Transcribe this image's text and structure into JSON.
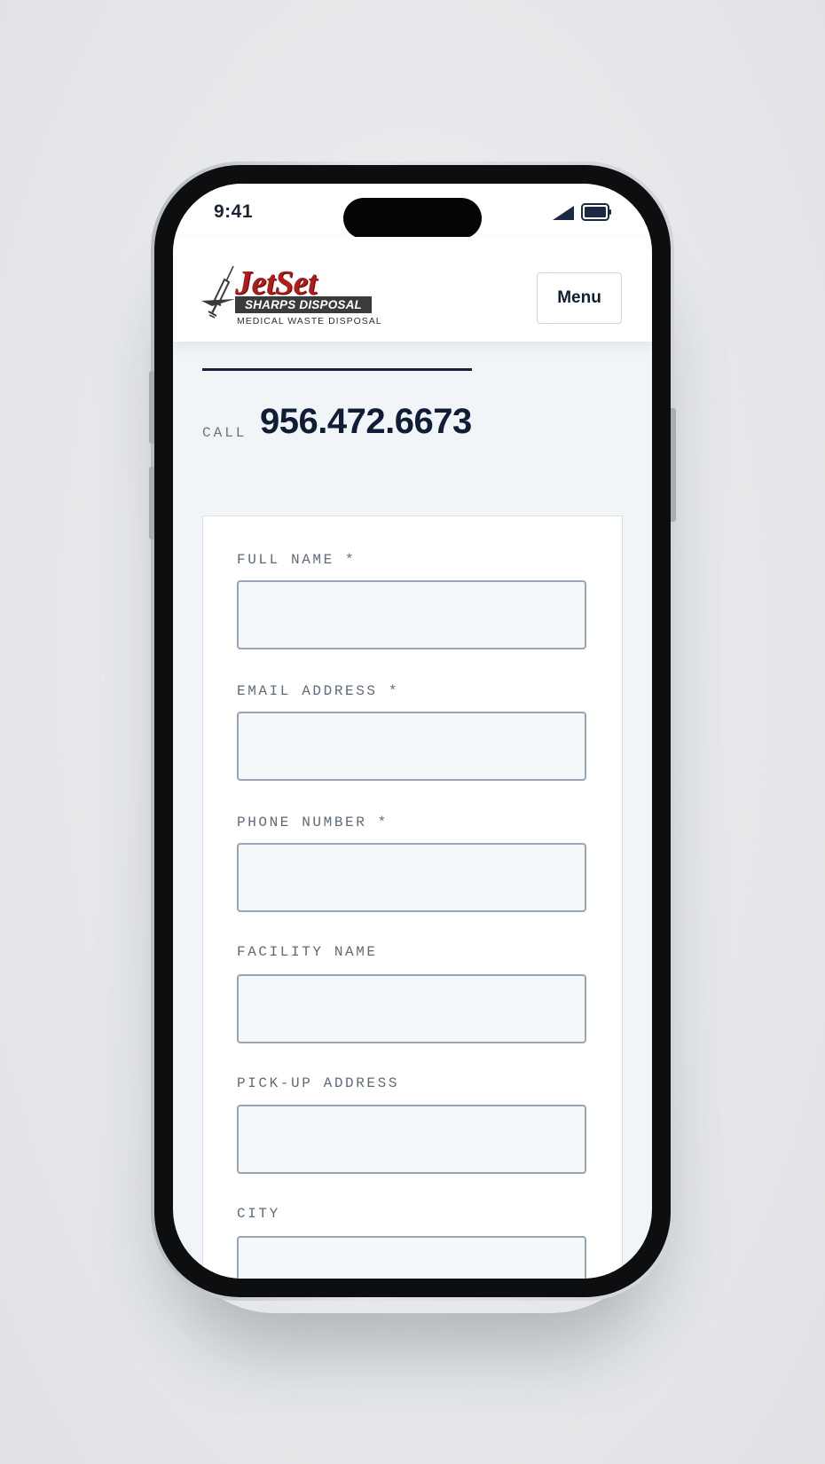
{
  "status_bar": {
    "time": "9:41",
    "icons": [
      "cellular-signal-icon",
      "battery-icon"
    ]
  },
  "header": {
    "logo": {
      "brand": "JetSet",
      "tagline": "SHARPS DISPOSAL",
      "subline": "MEDICAL WASTE DISPOSAL",
      "icon": "syringe-icon"
    },
    "menu_label": "Menu"
  },
  "call": {
    "label": "CALL",
    "number": "956.472.6673"
  },
  "form": {
    "fields": [
      {
        "label": "FULL NAME *",
        "value": "",
        "placeholder": ""
      },
      {
        "label": "EMAIL ADDRESS *",
        "value": "",
        "placeholder": ""
      },
      {
        "label": "PHONE NUMBER *",
        "value": "",
        "placeholder": ""
      },
      {
        "label": "FACILITY NAME",
        "value": "",
        "placeholder": ""
      },
      {
        "label": "PICK-UP ADDRESS",
        "value": "",
        "placeholder": ""
      },
      {
        "label": "CITY",
        "value": "",
        "placeholder": ""
      }
    ]
  },
  "colors": {
    "brand_red": "#b01c1c",
    "navy": "#0f1e36",
    "label_gray": "#5f6a7a",
    "input_border": "#9aa5b3",
    "input_bg": "#f5f8fb",
    "page_bg": "#f2f5f8"
  }
}
